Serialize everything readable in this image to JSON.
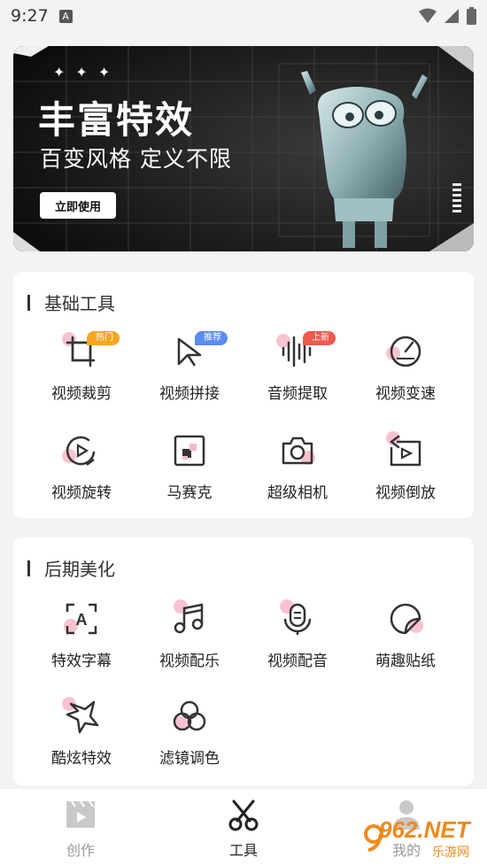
{
  "status_bar": {
    "time": "9:27",
    "badge": "A"
  },
  "banner": {
    "stars": "✦✦✦",
    "title": "丰富特效",
    "subtitle": "百变风格 定义不限",
    "button_label": "立即使用"
  },
  "basic_tools": {
    "title": "基础工具",
    "items": [
      {
        "label": "视频裁剪",
        "icon": "crop-icon",
        "tag": "热门"
      },
      {
        "label": "视频拼接",
        "icon": "splice-icon",
        "tag": "推荐"
      },
      {
        "label": "音频提取",
        "icon": "audio-wave-icon",
        "tag": "上新"
      },
      {
        "label": "视频变速",
        "icon": "speedometer-icon"
      },
      {
        "label": "视频旋转",
        "icon": "rotate-play-icon"
      },
      {
        "label": "马赛克",
        "icon": "mosaic-icon"
      },
      {
        "label": "超级相机",
        "icon": "camera-icon"
      },
      {
        "label": "视频倒放",
        "icon": "reverse-play-icon"
      }
    ]
  },
  "post_tools": {
    "title": "后期美化",
    "items": [
      {
        "label": "特效字幕",
        "icon": "subtitle-icon"
      },
      {
        "label": "视频配乐",
        "icon": "music-note-icon"
      },
      {
        "label": "视频配音",
        "icon": "microphone-icon"
      },
      {
        "label": "萌趣贴纸",
        "icon": "sticker-icon"
      },
      {
        "label": "酷炫特效",
        "icon": "star-effect-icon"
      },
      {
        "label": "滤镜调色",
        "icon": "filter-circles-icon"
      }
    ]
  },
  "bottom_nav": {
    "items": [
      {
        "label": "创作",
        "icon": "clapperboard-icon",
        "active": false
      },
      {
        "label": "工具",
        "icon": "scissors-icon",
        "active": true
      },
      {
        "label": "我的",
        "icon": "user-icon",
        "active": false
      }
    ]
  },
  "watermark": {
    "text": "962.NET",
    "sub": "乐游网"
  },
  "colors": {
    "accent_pink": "#f7b8c7",
    "tag_hot": "#f5a623",
    "tag_rec": "#5b8cf0",
    "tag_new": "#ee5a4f",
    "nav_active": "#222222",
    "nav_inactive": "#999999"
  }
}
